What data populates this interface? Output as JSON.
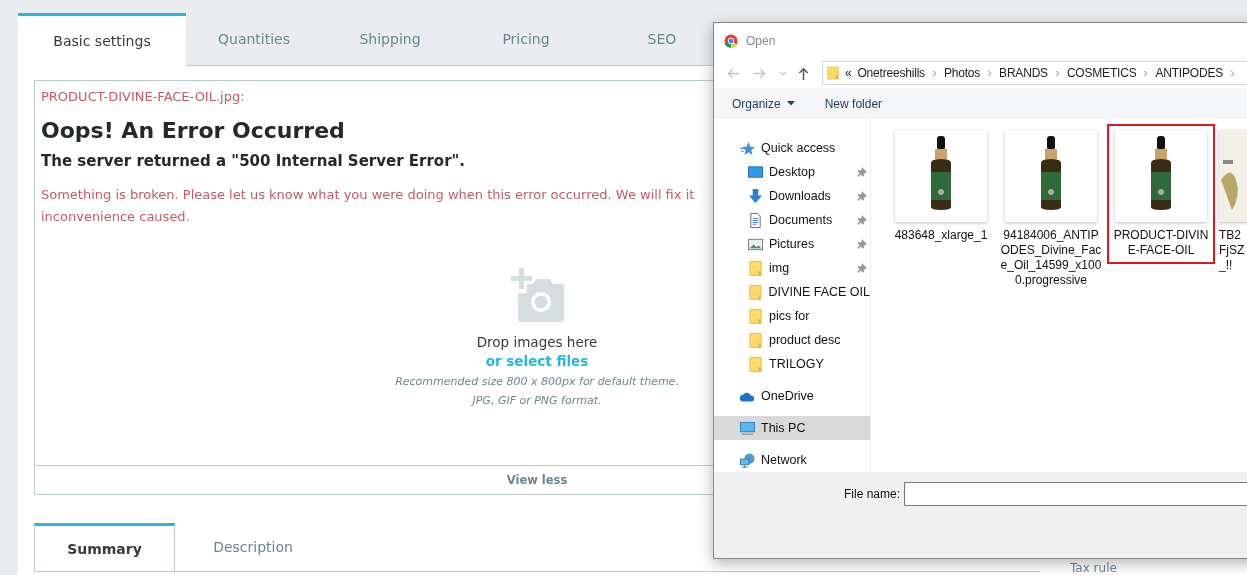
{
  "tabs": [
    {
      "label": "Basic settings",
      "selected": true
    },
    {
      "label": "Quantities",
      "selected": false
    },
    {
      "label": "Shipping",
      "selected": false
    },
    {
      "label": "Pricing",
      "selected": false
    },
    {
      "label": "SEO",
      "selected": false
    }
  ],
  "error": {
    "file": "PRODUCT-DIVINE-FACE-OIL.jpg:",
    "title": "Oops! An Error Occurred",
    "subtitle": "The server returned a \"500 Internal Server Error\".",
    "message_lines": [
      "Something is broken. Please let us know what you were doing when this error occurred. We will fix it",
      "inconvenience caused."
    ]
  },
  "dropzone": {
    "text": "Drop images here",
    "link": "or select files",
    "hints": [
      "Recommended size 800 x 800px for default theme.",
      "JPG, GIF or PNG format."
    ],
    "toggle": "View less"
  },
  "subtabs": [
    {
      "label": "Summary",
      "selected": true
    },
    {
      "label": "Description",
      "selected": false
    }
  ],
  "side_label": "Tax rule",
  "dialog": {
    "title": "Open",
    "path_overflow": "«",
    "path": [
      "Onetreeshills",
      "Photos",
      "BRANDS",
      "COSMETICS",
      "ANTIPODES"
    ],
    "toolbar": {
      "organize": "Organize",
      "new_folder": "New folder"
    },
    "nav": [
      {
        "label": "Quick access",
        "kind": "star",
        "pinned": false,
        "selected": false
      },
      {
        "label": "Desktop",
        "kind": "desktop",
        "pinned": true,
        "selected": false
      },
      {
        "label": "Downloads",
        "kind": "download",
        "pinned": true,
        "selected": false
      },
      {
        "label": "Documents",
        "kind": "document",
        "pinned": true,
        "selected": false
      },
      {
        "label": "Pictures",
        "kind": "pictures",
        "pinned": true,
        "selected": false
      },
      {
        "label": "img",
        "kind": "folder",
        "pinned": true,
        "selected": false
      },
      {
        "label": "DIVINE FACE OIL",
        "kind": "folder",
        "pinned": false,
        "selected": false
      },
      {
        "label": "pics for",
        "kind": "folder",
        "pinned": false,
        "selected": false
      },
      {
        "label": "product desc",
        "kind": "folder",
        "pinned": false,
        "selected": false
      },
      {
        "label": "TRILOGY",
        "kind": "folder",
        "pinned": false,
        "selected": false
      },
      {
        "label": "OneDrive",
        "kind": "cloud",
        "pinned": false,
        "selected": false
      },
      {
        "label": "This PC",
        "kind": "pc",
        "pinned": false,
        "selected": true
      },
      {
        "label": "Network",
        "kind": "network",
        "pinned": false,
        "selected": false
      }
    ],
    "files": [
      {
        "lines": [
          "483648_xlarge_1"
        ],
        "selected": false
      },
      {
        "lines": [
          "94184006_ANTIP",
          "ODES_Divine_Fac",
          "e_Oil_14599_x100",
          "0.progressive"
        ],
        "selected": false
      },
      {
        "lines": [
          "PRODUCT-DIVIN",
          "E-FACE-OIL"
        ],
        "selected": true
      },
      {
        "lines": [
          "TB2",
          "FjSZ",
          "_!!"
        ],
        "selected": false
      }
    ],
    "file_name_label": "File name:"
  }
}
